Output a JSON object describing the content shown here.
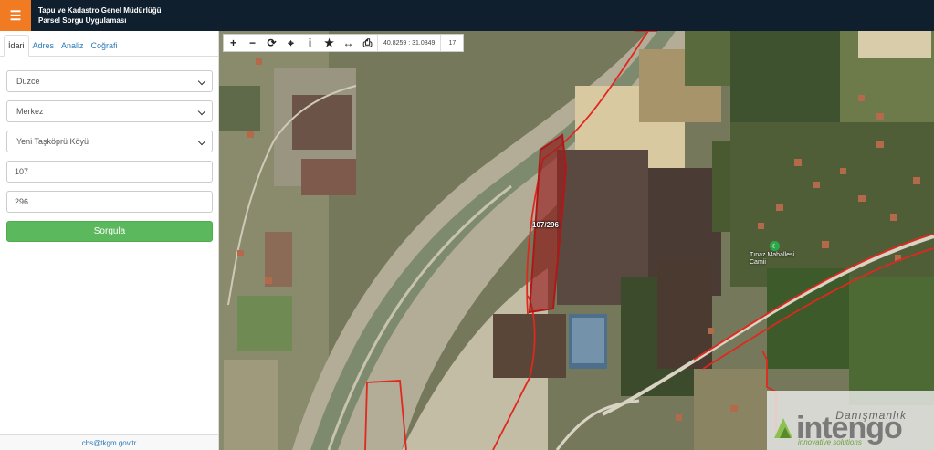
{
  "header": {
    "title_line1": "Tapu ve Kadastro Genel Müdürlüğü",
    "title_line2": "Parsel Sorgu Uygulaması",
    "menu_icon": "hamburger-icon",
    "accent_color": "#f07b22"
  },
  "sidebar": {
    "tabs": [
      {
        "label": "İdari",
        "active": true
      },
      {
        "label": "Adres",
        "active": false
      },
      {
        "label": "Analiz",
        "active": false
      },
      {
        "label": "Coğrafi",
        "active": false
      }
    ],
    "form": {
      "province": "Duzce",
      "district": "Merkez",
      "neighborhood": "Yeni Taşköprü Köyü",
      "block": "107",
      "parcel": "296",
      "submit_label": "Sorgula"
    },
    "footer_text": "cbs@tkgm.gov.tr"
  },
  "map": {
    "toolbar": {
      "coordinates": "40.8259 : 31.0849",
      "zoom": "17"
    },
    "parcel_label": "107/296",
    "place_label_line1": "Tınaz Mahallesi",
    "place_label_line2": "Camii"
  },
  "watermark": {
    "top": "Danışmanlık",
    "main": "intengo",
    "sub": "innovative solutions"
  }
}
